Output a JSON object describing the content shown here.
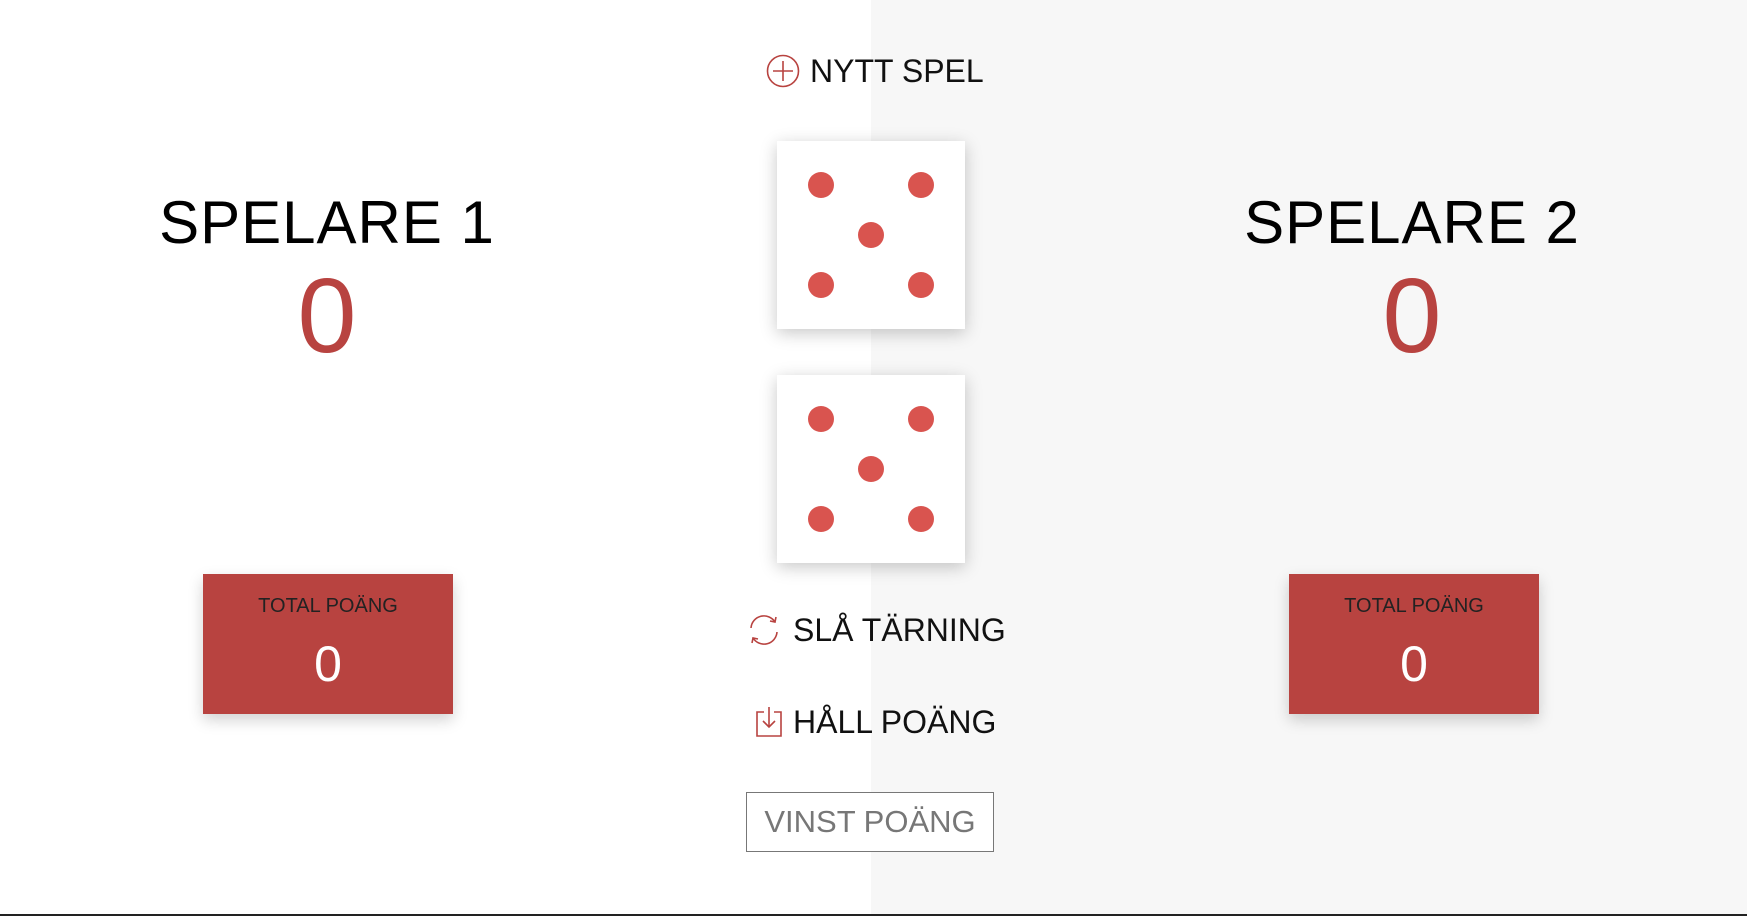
{
  "colors": {
    "accent": "#b84340",
    "pip": "#d9544f",
    "right_panel_bg": "#f7f7f7",
    "left_panel_bg": "#ffffff"
  },
  "buttons": {
    "new_game": {
      "label": "NYTT SPEL",
      "icon": "circle-plus-icon"
    },
    "roll": {
      "label": "SLÅ TÄRNING",
      "icon": "refresh-icon"
    },
    "hold": {
      "label": "HÅLL POÄNG",
      "icon": "download-icon"
    }
  },
  "win_score_input": {
    "placeholder": "VINST POÄNG",
    "value": ""
  },
  "players": [
    {
      "name": "SPELARE 1",
      "current_score": "0",
      "total_label": "TOTAL POÄNG",
      "total_score": "0"
    },
    {
      "name": "SPELARE 2",
      "current_score": "0",
      "total_label": "TOTAL POÄNG",
      "total_score": "0"
    }
  ],
  "dice": [
    {
      "value": 5
    },
    {
      "value": 5
    }
  ]
}
